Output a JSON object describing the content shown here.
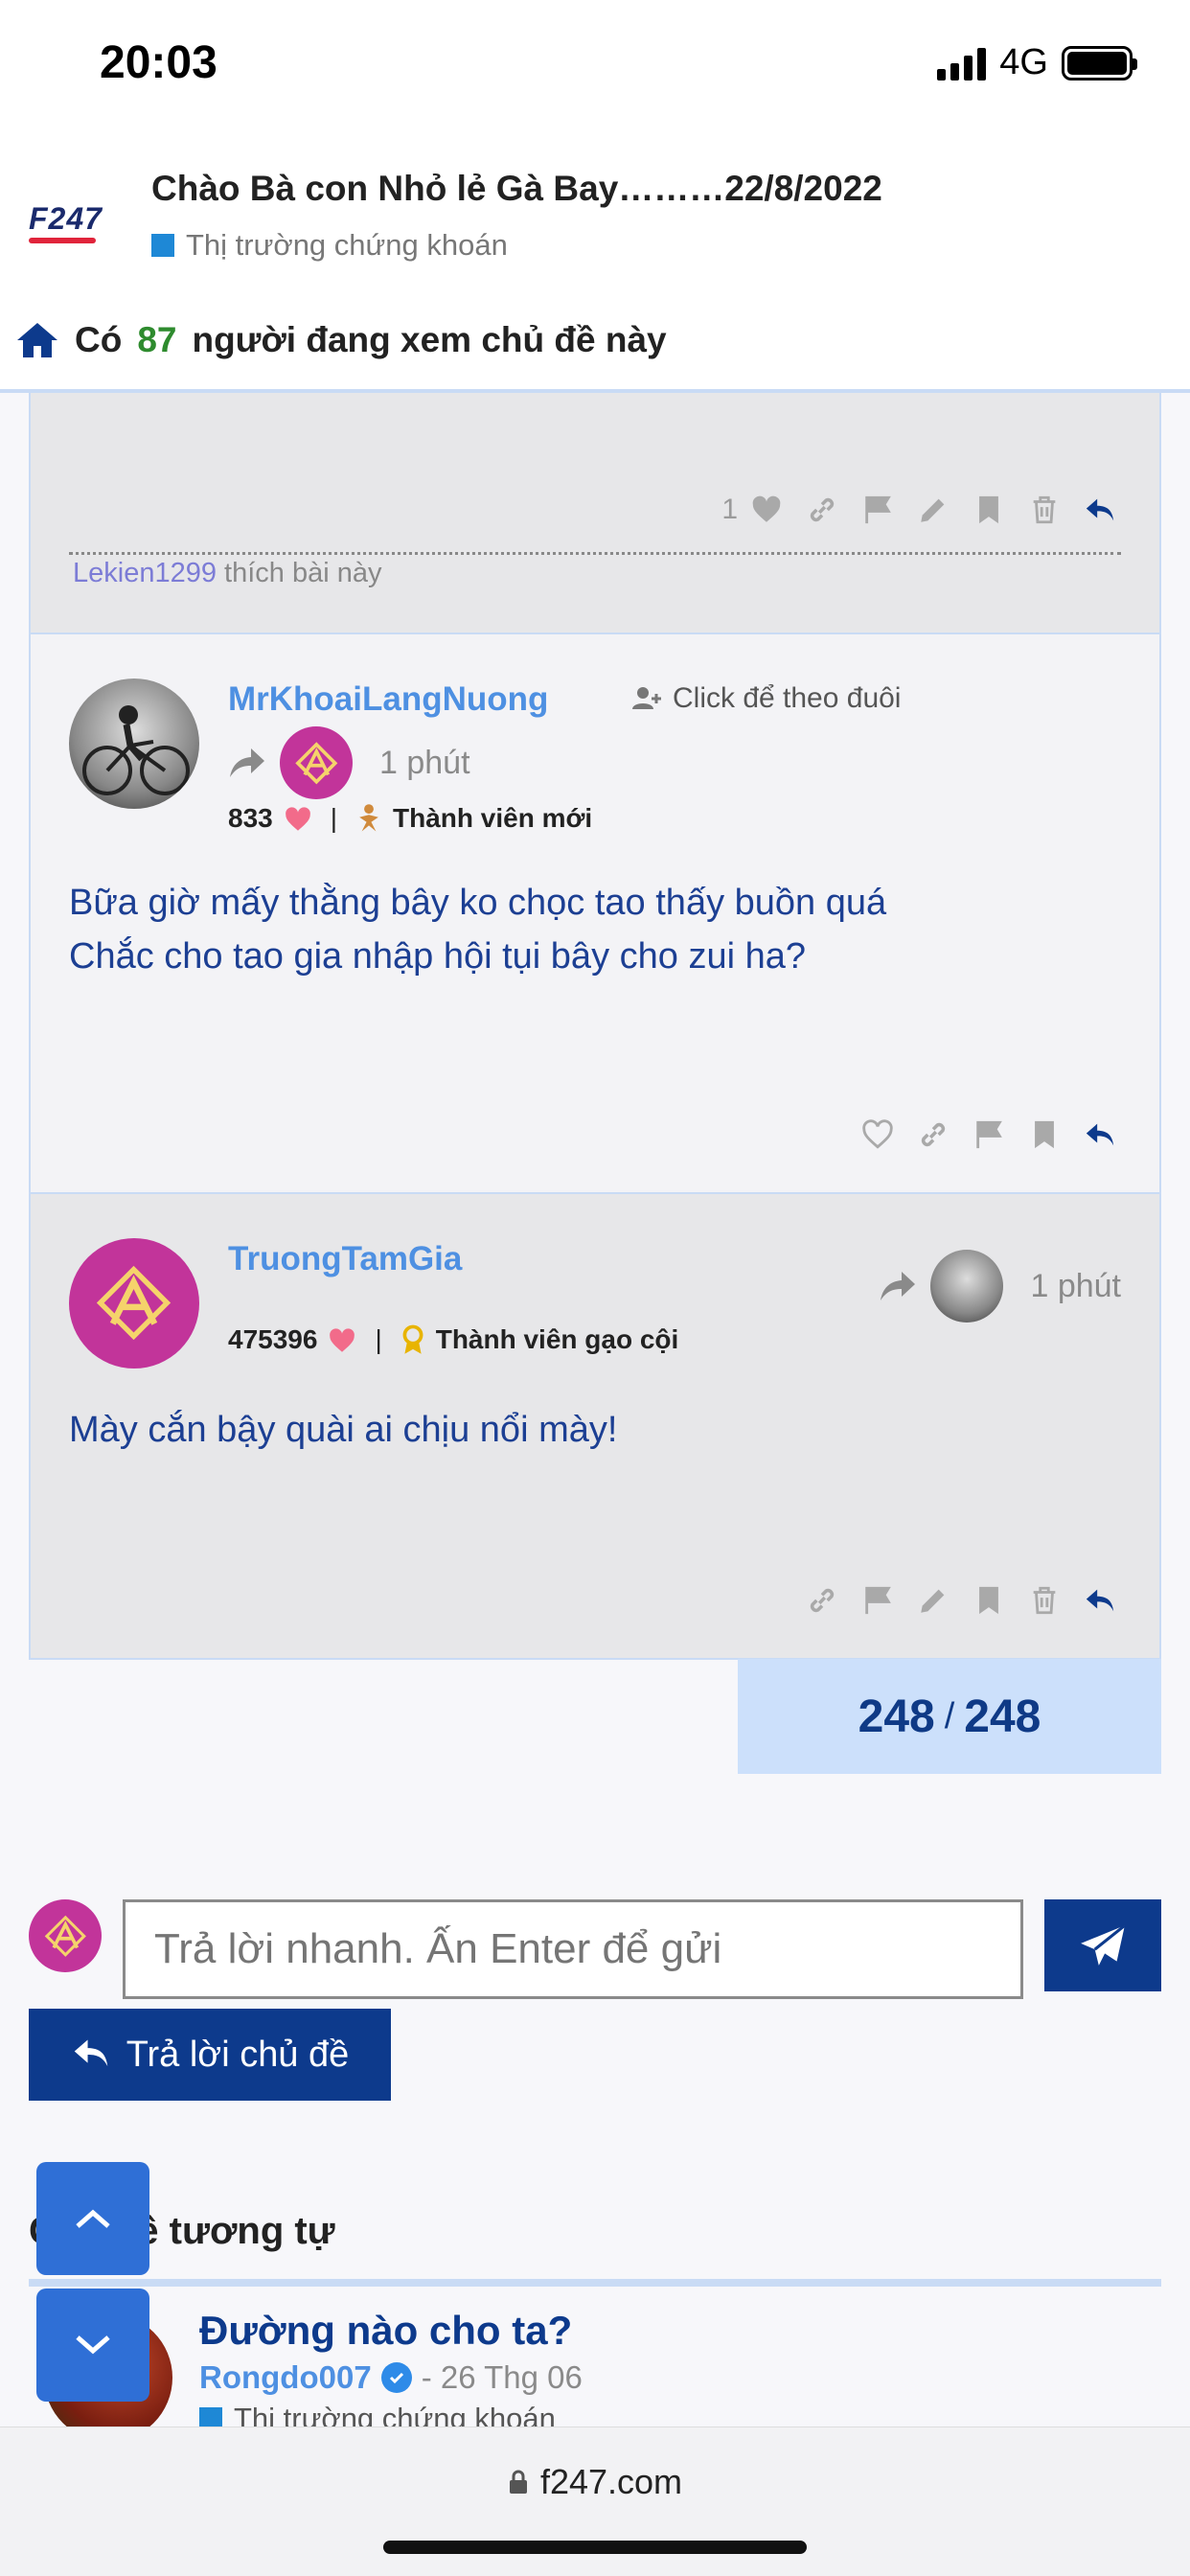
{
  "status": {
    "time": "20:03",
    "network": "4G"
  },
  "thread": {
    "logo": "F247",
    "title": "Chào Bà con Nhỏ lẻ Gà Bay………22/8/2022",
    "category": "Thị trường chứng khoán",
    "viewers_prefix": "Có",
    "viewers_count": "87",
    "viewers_suffix": "người đang xem chủ đề này"
  },
  "prev_post": {
    "like_count": "1",
    "liked_by": "Lekien1299",
    "liked_suffix": "thích bài này"
  },
  "posts": [
    {
      "username": "MrKhoaiLangNuong",
      "follow_label": "Click để theo đuôi",
      "time": "1 phút",
      "hearts": "833",
      "rank": "Thành viên mới",
      "body_line1": "Bữa giờ mấy thằng bây ko chọc tao thấy buồn quá",
      "body_line2": "Chắc cho tao gia nhập hội tụi bây cho zui ha?"
    },
    {
      "username": "TruongTamGia",
      "time": "1 phút",
      "hearts": "475396",
      "rank": "Thành viên gạo cội",
      "body_line1": "Mày cắn bậy quài ai chịu nổi mày!"
    }
  ],
  "pagination": {
    "current": "248",
    "separator": "/",
    "total": "248"
  },
  "quick_reply": {
    "placeholder": "Trả lời nhanh. Ấn Enter để gửi",
    "reply_button": "Trả lời chủ đề"
  },
  "similar": {
    "heading": "Chủ đề tương tự",
    "items": [
      {
        "title": "Đường nào cho ta?",
        "author": "Rongdo007",
        "date": "- 26 Thg 06",
        "category": "Thị trường chứng khoán"
      }
    ]
  },
  "browser": {
    "url": "f247.com"
  },
  "colors": {
    "primary": "#0d3a8c",
    "link": "#4e90e2",
    "brand_avatar": "#c2349a",
    "pager_bg": "#cce0fb"
  }
}
